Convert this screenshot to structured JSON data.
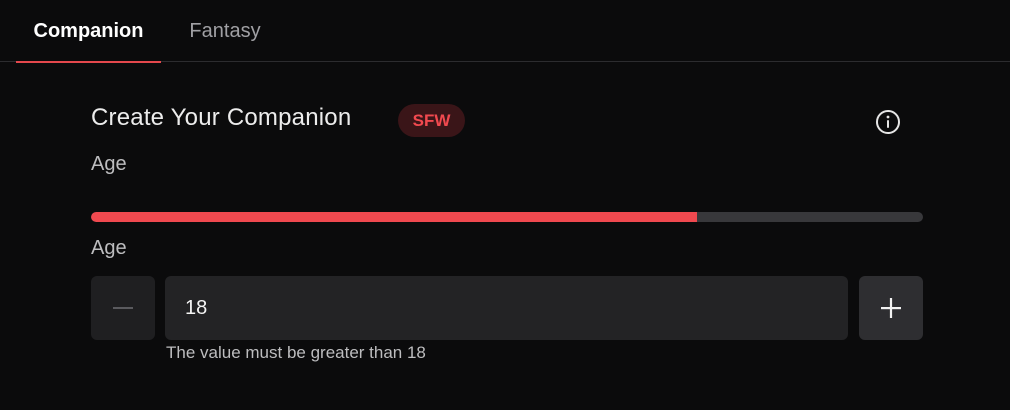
{
  "tabs": [
    {
      "label": "Companion",
      "active": true
    },
    {
      "label": "Fantasy",
      "active": false
    }
  ],
  "header": {
    "title": "Create Your Companion",
    "badge": "SFW",
    "info_icon": "info-circle-icon"
  },
  "section_label": "Age",
  "progress": {
    "value": 0.728
  },
  "age_field": {
    "label": "Age",
    "value": "18",
    "hint": "The value must be greater than 18",
    "minus_icon": "minus-icon",
    "plus_icon": "plus-icon"
  },
  "colors": {
    "accent": "#f0494f",
    "badge_bg": "#3a1518",
    "background": "#0b0b0c"
  }
}
